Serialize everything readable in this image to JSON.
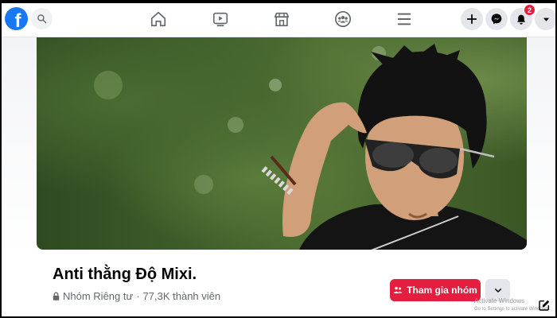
{
  "topbar": {
    "logo_letter": "f",
    "notifications_badge": "2"
  },
  "group": {
    "name": "Anti thằng Độ Mixi.",
    "privacy_label": "Nhóm Riêng tư",
    "separator": "·",
    "member_count": "77,3K thành viên"
  },
  "actions": {
    "join_label": "Tham gia nhóm"
  },
  "watermark": {
    "line1": "Activate Windows",
    "line2": "Go to Settings to activate Windows."
  },
  "colors": {
    "facebook_blue": "#1877f2",
    "join_red": "#e41e3f",
    "badge_red": "#e41e3f"
  }
}
